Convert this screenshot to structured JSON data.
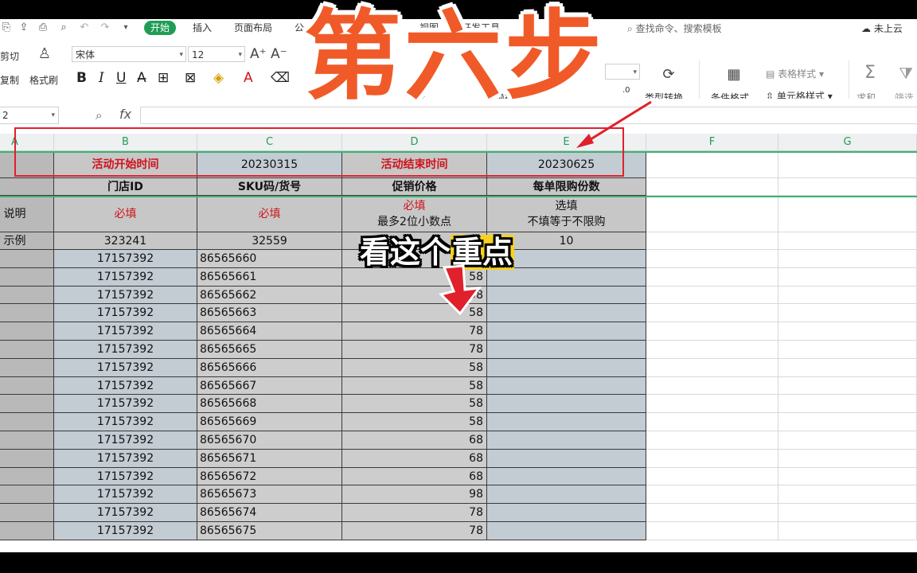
{
  "menubar": {
    "tabs": [
      "开始",
      "插入",
      "页面布局",
      "公",
      "视图",
      "开发工具"
    ],
    "active_tab": "开始",
    "search_placeholder": "查找命令、搜索模板",
    "cloud_status": "未上云"
  },
  "ribbon": {
    "cut_label": "剪切",
    "copy_label": "复制",
    "format_painter_label": "格式刷",
    "font_name": "宋体",
    "font_size": "12",
    "wrap_label": "换行",
    "type_convert_label": "类型转换",
    "cond_format_label": "条件格式",
    "table_style_label": "表格样式",
    "cell_style_label": "单元格样式",
    "sum_label": "求和",
    "filter_label": "筛选",
    "merge_label": "合"
  },
  "formula_bar": {
    "name_box": "2",
    "fx_label": "fx",
    "formula": ""
  },
  "columns": [
    "A",
    "B",
    "C",
    "D",
    "E",
    "F",
    "G"
  ],
  "header_rows": [
    {
      "a": "",
      "b": "活动开始时间",
      "c": "20230315",
      "d": "活动结束时间",
      "e": "20230625"
    },
    {
      "a": "",
      "b": "门店ID",
      "c": "SKU码/货号",
      "d": "促销价格",
      "e": "每单限购份数"
    },
    {
      "a": "说明",
      "b": "必填",
      "c": "必填",
      "d1": "必填",
      "d2": "最多2位小数点",
      "e1": "选填",
      "e2": "不填等于不限购"
    },
    {
      "a": "示例",
      "b": "323241",
      "c": "32559",
      "d": "",
      "e": "10"
    }
  ],
  "data_rows": [
    {
      "store": "17157392",
      "sku": "86565660",
      "price": ""
    },
    {
      "store": "17157392",
      "sku": "86565661",
      "price": "58"
    },
    {
      "store": "17157392",
      "sku": "86565662",
      "price": "58"
    },
    {
      "store": "17157392",
      "sku": "86565663",
      "price": "58"
    },
    {
      "store": "17157392",
      "sku": "86565664",
      "price": "78"
    },
    {
      "store": "17157392",
      "sku": "86565665",
      "price": "78"
    },
    {
      "store": "17157392",
      "sku": "86565666",
      "price": "58"
    },
    {
      "store": "17157392",
      "sku": "86565667",
      "price": "58"
    },
    {
      "store": "17157392",
      "sku": "86565668",
      "price": "58"
    },
    {
      "store": "17157392",
      "sku": "86565669",
      "price": "58"
    },
    {
      "store": "17157392",
      "sku": "86565670",
      "price": "68"
    },
    {
      "store": "17157392",
      "sku": "86565671",
      "price": "68"
    },
    {
      "store": "17157392",
      "sku": "86565672",
      "price": "68"
    },
    {
      "store": "17157392",
      "sku": "86565673",
      "price": "98"
    },
    {
      "store": "17157392",
      "sku": "86565674",
      "price": "78"
    },
    {
      "store": "17157392",
      "sku": "86565675",
      "price": "78"
    }
  ],
  "overlay": {
    "title": "第六步",
    "note_prefix": "看这个",
    "note_highlight": "重点"
  },
  "colors": {
    "accent_green": "#1f9d55",
    "required_red": "#d0121b",
    "title_orange": "#f05a28",
    "highlight_yellow": "#f7d21e"
  }
}
